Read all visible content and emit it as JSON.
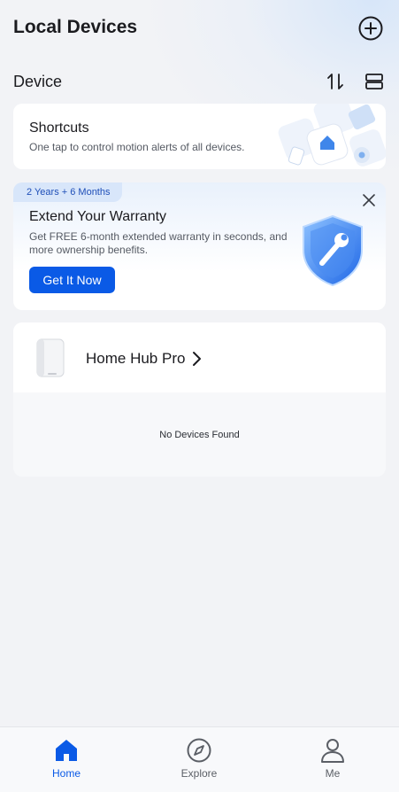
{
  "header": {
    "title": "Local Devices",
    "add_icon": "plus-circle-icon"
  },
  "section": {
    "title": "Device",
    "sort_icon": "sort-arrows-icon",
    "layout_icon": "list-layout-icon"
  },
  "shortcuts": {
    "title": "Shortcuts",
    "subtitle": "One tap to control motion alerts of all devices."
  },
  "warranty": {
    "badge": "2 Years + 6 Months",
    "title": "Extend Your Warranty",
    "description": "Get FREE 6-month extended warranty in seconds, and more ownership benefits.",
    "button_label": "Get It Now",
    "accent_color": "#0a5ae6"
  },
  "hub": {
    "name": "Home Hub Pro",
    "empty_text": "No Devices Found"
  },
  "tabs": [
    {
      "label": "Home",
      "icon": "home-icon",
      "active": true,
      "color": "#0a5ae6"
    },
    {
      "label": "Explore",
      "icon": "compass-icon",
      "active": false,
      "color": "#5b5f66"
    },
    {
      "label": "Me",
      "icon": "person-icon",
      "active": false,
      "color": "#5b5f66"
    }
  ]
}
